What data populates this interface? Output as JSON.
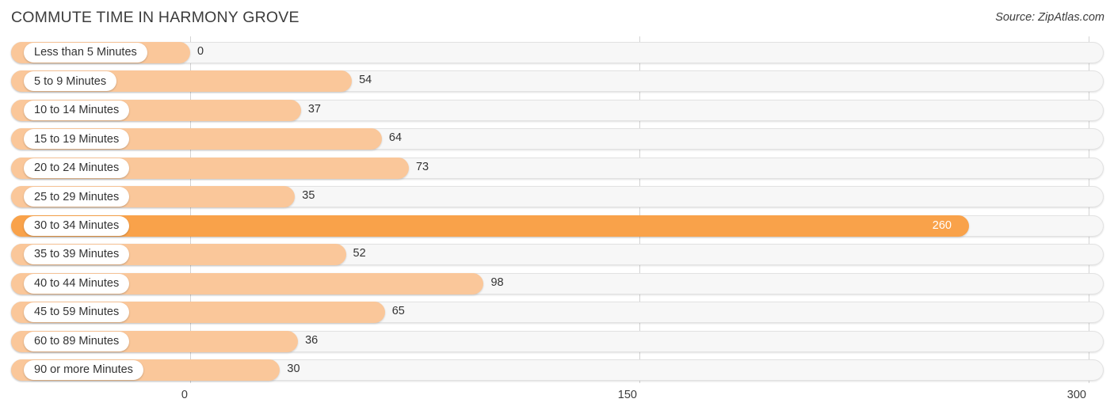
{
  "header": {
    "title": "COMMUTE TIME IN HARMONY GROVE",
    "source": "Source: ZipAtlas.com"
  },
  "colors": {
    "bar": "#fac79a",
    "bar_highlight": "#f9a24a",
    "track": "#f7f7f7",
    "gridline": "#d4d4d4",
    "text": "#333333",
    "value_in_bar": "#ffffff"
  },
  "axis": {
    "ticks": [
      "0",
      "150",
      "300"
    ],
    "min": 0,
    "max": 300
  },
  "chart_data": {
    "type": "bar",
    "orientation": "horizontal",
    "title": "COMMUTE TIME IN HARMONY GROVE",
    "subtitle": "Source: ZipAtlas.com",
    "xlabel": "",
    "ylabel": "",
    "xlim": [
      0,
      300
    ],
    "grid": true,
    "legend": false,
    "categories": [
      "Less than 5 Minutes",
      "5 to 9 Minutes",
      "10 to 14 Minutes",
      "15 to 19 Minutes",
      "20 to 24 Minutes",
      "25 to 29 Minutes",
      "30 to 34 Minutes",
      "35 to 39 Minutes",
      "40 to 44 Minutes",
      "45 to 59 Minutes",
      "60 to 89 Minutes",
      "90 or more Minutes"
    ],
    "values": [
      0,
      54,
      37,
      64,
      73,
      35,
      260,
      52,
      98,
      65,
      36,
      30
    ],
    "xticks": [
      0,
      150,
      300
    ],
    "highlight_index": 6
  },
  "rows": [
    {
      "label": "Less than 5 Minutes",
      "value": 0,
      "value_text": "0",
      "highlight": false
    },
    {
      "label": "5 to 9 Minutes",
      "value": 54,
      "value_text": "54",
      "highlight": false
    },
    {
      "label": "10 to 14 Minutes",
      "value": 37,
      "value_text": "37",
      "highlight": false
    },
    {
      "label": "15 to 19 Minutes",
      "value": 64,
      "value_text": "64",
      "highlight": false
    },
    {
      "label": "20 to 24 Minutes",
      "value": 73,
      "value_text": "73",
      "highlight": false
    },
    {
      "label": "25 to 29 Minutes",
      "value": 35,
      "value_text": "35",
      "highlight": false
    },
    {
      "label": "30 to 34 Minutes",
      "value": 260,
      "value_text": "260",
      "highlight": true
    },
    {
      "label": "35 to 39 Minutes",
      "value": 52,
      "value_text": "52",
      "highlight": false
    },
    {
      "label": "40 to 44 Minutes",
      "value": 98,
      "value_text": "98",
      "highlight": false
    },
    {
      "label": "45 to 59 Minutes",
      "value": 65,
      "value_text": "65",
      "highlight": false
    },
    {
      "label": "60 to 89 Minutes",
      "value": 36,
      "value_text": "36",
      "highlight": false
    },
    {
      "label": "90 or more Minutes",
      "value": 30,
      "value_text": "30",
      "highlight": false
    }
  ]
}
